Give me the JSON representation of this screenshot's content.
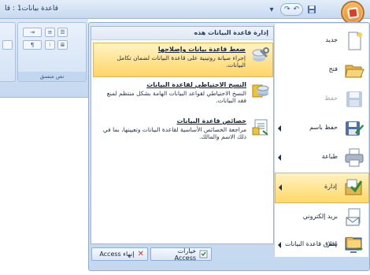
{
  "window": {
    "title": "قاعدة بيانات1 : قا"
  },
  "qat": {
    "undo_symbol": "↶",
    "redo_symbol": "↷",
    "dropdown_symbol": "▾"
  },
  "ribbon": {
    "group_label": "نص منسق"
  },
  "menu": {
    "commands": [
      {
        "label": "جديد",
        "icon": "new-document-icon",
        "dim": false,
        "arrow": false
      },
      {
        "label": "فتح",
        "icon": "open-folder-icon",
        "dim": false,
        "arrow": false
      },
      {
        "label": "حفظ",
        "icon": "save-disk-icon",
        "dim": true,
        "arrow": false
      },
      {
        "label": "حفظ باسم",
        "icon": "save-as-icon",
        "dim": false,
        "arrow": true
      },
      {
        "label": "طباعة",
        "icon": "printer-icon",
        "dim": false,
        "arrow": true
      },
      {
        "label": "إدارة",
        "icon": "manage-icon",
        "dim": false,
        "arrow": true,
        "selected": true
      },
      {
        "label": "بريد إلكتروني",
        "icon": "email-icon",
        "dim": false,
        "arrow": false
      },
      {
        "label": "نشر",
        "icon": "publish-icon",
        "dim": false,
        "arrow": true
      },
      {
        "label": "إغلاق قاعدة البيانات",
        "icon": "close-database-icon",
        "dim": false,
        "arrow": false
      }
    ],
    "panel": {
      "heading": "إدارة قاعدة البيانات هذه",
      "items": [
        {
          "title": "ضغط قاعدة بيانات وإصلاحها",
          "desc": "إجراء صيانة روتينية على قاعدة البيانات لضمان تكامل البيانات.",
          "icon": "compact-repair-icon",
          "selected": true
        },
        {
          "title": "النسخ الاحتياطي لقاعدة البيانات",
          "desc": "النسخ الاحتياطي لقواعد البيانات الهامة بشكل منتظم لمنع فقد البيانات.",
          "icon": "backup-database-icon",
          "selected": false
        },
        {
          "title": "خصائص قاعدة البيانات",
          "desc": "مراجعة الخصائص الأساسية لقاعدة البيانات وتعيينها، بما في ذلك الاسم والمالك.",
          "icon": "database-properties-icon",
          "selected": false
        }
      ]
    },
    "options_button": "خيارات Access",
    "exit_button": "إنهاء Access"
  }
}
